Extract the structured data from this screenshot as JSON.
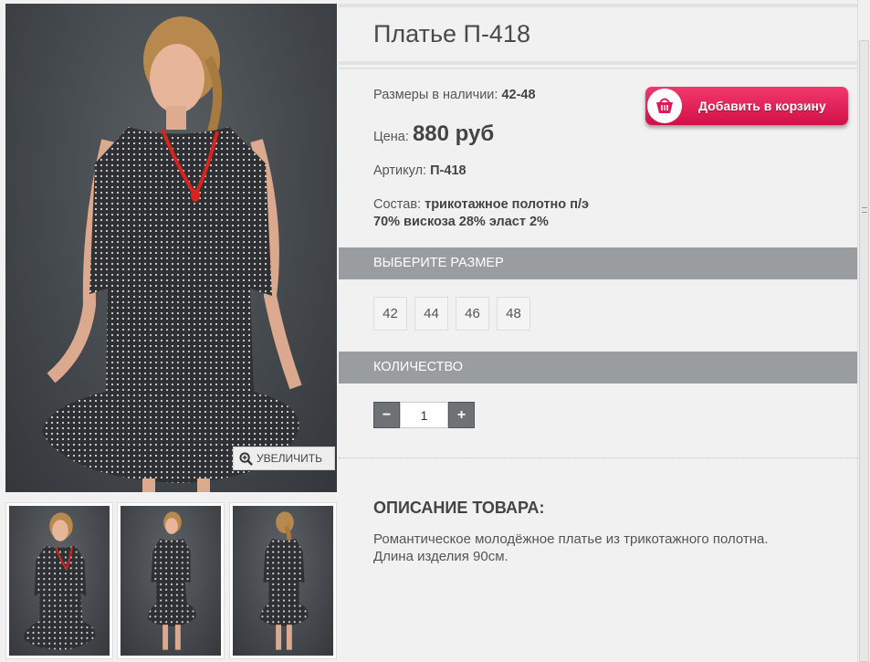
{
  "product": {
    "title": "Платье П-418",
    "sizes_label": "Размеры в наличии:",
    "sizes_value": "42-48",
    "price_label": "Цена:",
    "price_value": "880 руб",
    "article_label": "Артикул:",
    "article_value": "П-418",
    "composition_label": "Состав:",
    "composition_line1": "трикотажное полотно п/э",
    "composition_line2": "70% вискоза 28% эласт 2%"
  },
  "cart_button": {
    "label": "Добавить в корзину",
    "icon": "basket-icon",
    "color": "#e0195a"
  },
  "gallery": {
    "zoom_label": "УВЕЛИЧИТЬ",
    "zoom_icon": "magnifier-plus-icon"
  },
  "size_section": {
    "header": "ВЫБЕРИТЕ РАЗМЕР",
    "options": [
      "42",
      "44",
      "46",
      "48"
    ]
  },
  "quantity_section": {
    "header": "КОЛИЧЕСТВО",
    "minus": "−",
    "plus": "+",
    "value": "1"
  },
  "description": {
    "title": "ОПИСАНИЕ ТОВАРА:",
    "line1": "Романтическое молодёжное платье из трикотажного полотна.",
    "line2": "Длина изделия 90см."
  },
  "colors": {
    "bar": "#9a9da0",
    "background": "#f1f1f1",
    "accent": "#e0195a"
  }
}
